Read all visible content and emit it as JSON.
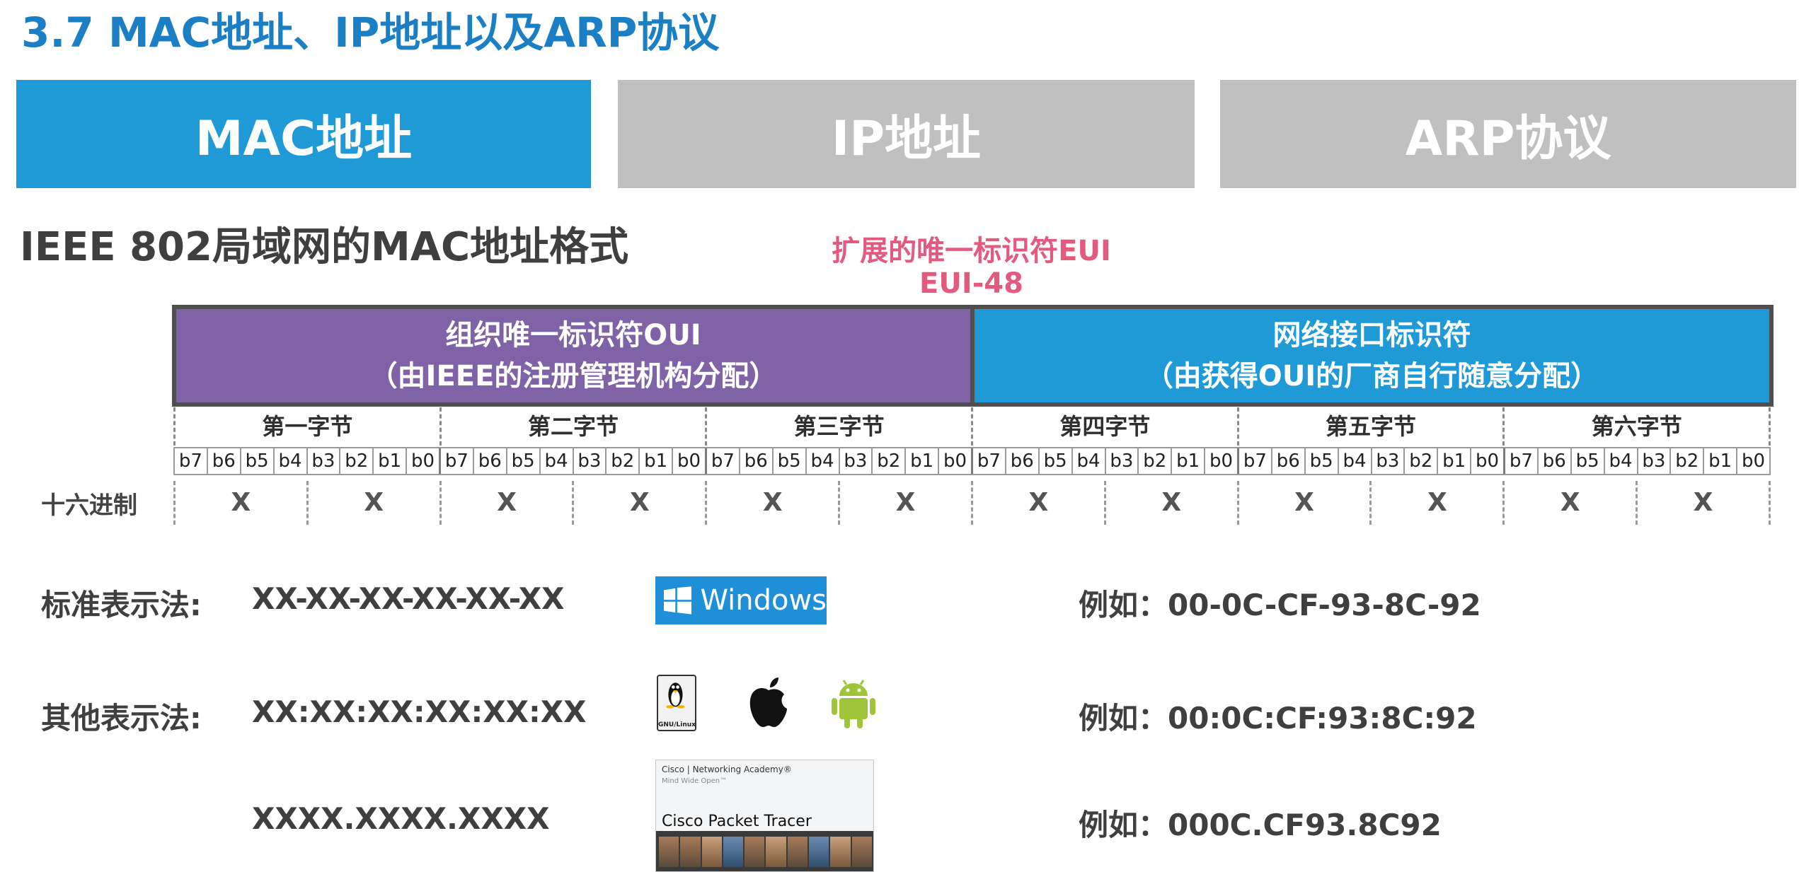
{
  "header": {
    "title": "3.7 MAC地址、IP地址以及ARP协议"
  },
  "tabs": [
    {
      "label": "MAC地址",
      "active": true
    },
    {
      "label": "IP地址",
      "active": false
    },
    {
      "label": "ARP协议",
      "active": false
    }
  ],
  "section": {
    "title": "IEEE 802局域网的MAC地址格式"
  },
  "eui": {
    "line1": "扩展的唯一标识符EUI",
    "line2": "EUI-48"
  },
  "oui": {
    "line1": "组织唯一标识符OUI",
    "line2": "（由IEEE的注册管理机构分配）"
  },
  "nic": {
    "line1": "网络接口标识符",
    "line2": "（由获得OUI的厂商自行随意分配）"
  },
  "bytes": [
    "第一字节",
    "第二字节",
    "第三字节",
    "第四字节",
    "第五字节",
    "第六字节"
  ],
  "bits": [
    "b7",
    "b6",
    "b5",
    "b4",
    "b3",
    "b2",
    "b1",
    "b0"
  ],
  "hex": {
    "label": "十六进制",
    "digit": "X",
    "count": 12
  },
  "notations": {
    "standard": {
      "label": "标准表示法:",
      "format": "XX-XX-XX-XX-XX-XX",
      "example": "例如：00-0C-CF-93-8C-92"
    },
    "other": {
      "label": "其他表示法:",
      "format": "XX:XX:XX:XX:XX:XX",
      "example": "例如：00:0C:CF:93:8C:92"
    },
    "dotted": {
      "format": "XXXX.XXXX.XXXX",
      "example": "例如：000C.CF93.8C92"
    }
  },
  "logos": {
    "windows": {
      "text": "Windows",
      "icon": "windows-icon"
    },
    "linux": {
      "text": "GNU/Linux",
      "icon": "linux-tux-icon"
    },
    "apple": {
      "icon": "apple-icon"
    },
    "android": {
      "icon": "android-icon"
    },
    "cisco": {
      "header": "Cisco | Networking Academy®",
      "subheader": "Mind Wide Open™",
      "name": "Cisco Packet Tracer"
    }
  },
  "colors": {
    "title": "#1a7fc4",
    "tab_active": "#1f9ad6",
    "tab_inactive": "#c0c0c0",
    "oui": "#7f63a6",
    "nic": "#1f9ad6",
    "eui": "#e45a7f"
  }
}
